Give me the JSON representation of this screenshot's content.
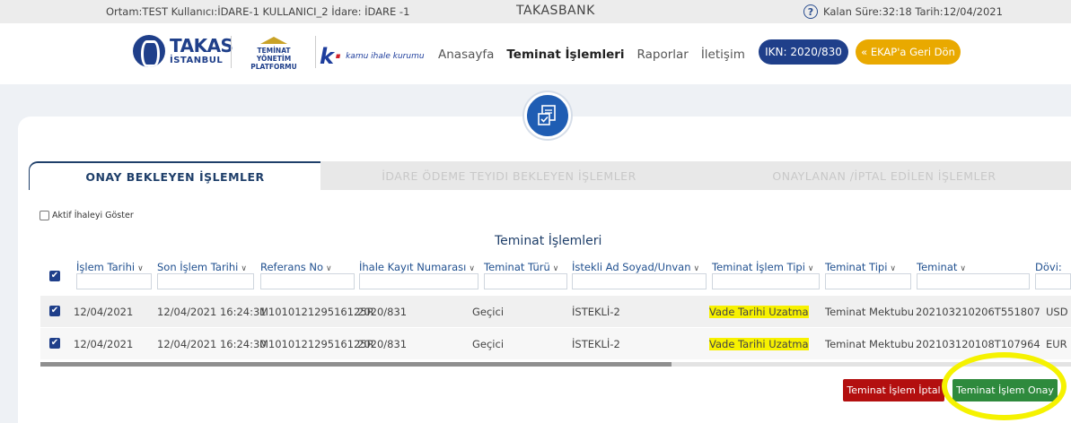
{
  "topbar": {
    "env_info": "Ortam:TEST  Kullanıcı:İDARE-1 KULLANICI_2  İdare: İDARE -1",
    "brand": "TAKASBANK",
    "session_info": "Kalan Süre:32:18  Tarih:12/04/2021",
    "help_icon": "?"
  },
  "logos": {
    "takas_line1": "TAKAS",
    "takas_line2": "İSTANBUL",
    "tvp_line1": "TEMİNAT",
    "tvp_line2": "YÖNETİM PLATFORMU",
    "kik_text": "kamu ihale kurumu"
  },
  "nav": {
    "items": [
      "Anasayfa",
      "Teminat İşlemleri",
      "Raporlar",
      "İletişim"
    ],
    "active_index": 1
  },
  "buttons": {
    "ikn": "IKN: 2020/830",
    "ekap": "« EKAP'a Geri Dön",
    "iptal": "Teminat İşlem İptal",
    "onay": "Teminat İşlem Onay"
  },
  "tabs": [
    "ONAY BEKLEYEN İŞLEMLER",
    "İDARE ÖDEME TEYIDI BEKLEYEN İŞLEMLER",
    "ONAYLANAN /İPTAL EDİLEN İŞLEMLER"
  ],
  "aktif_label": "Aktif İhaleyi Göster",
  "table": {
    "title": "Teminat İşlemleri",
    "columns": [
      "İşlem Tarihi",
      "Son İşlem Tarihi",
      "Referans No",
      "İhale Kayıt Numarası",
      "Teminat Türü",
      "İstekli Ad Soyad/Unvan",
      "Teminat İşlem Tipi",
      "Teminat Tipi",
      "Teminat",
      "Dövi:"
    ],
    "rows": [
      [
        "12/04/2021",
        "12/04/2021 16:24:31",
        "M101012129516125R",
        "2020/831",
        "Geçici",
        "İSTEKLİ-2",
        "Vade Tarihi Uzatma",
        "Teminat Mektubu",
        "202103210206T551807",
        "USD"
      ],
      [
        "12/04/2021",
        "12/04/2021 16:24:30",
        "M101012129516125R",
        "2020/831",
        "Geçici",
        "İSTEKLİ-2",
        "Vade Tarihi Uzatma",
        "Teminat Mektubu",
        "202103120108T107964",
        "EUR"
      ]
    ]
  },
  "colors": {
    "primary": "#1f3f8a",
    "accent": "#e9a900",
    "danger": "#b30f0f",
    "success": "#2e8a3d",
    "highlight": "#f7f100"
  }
}
